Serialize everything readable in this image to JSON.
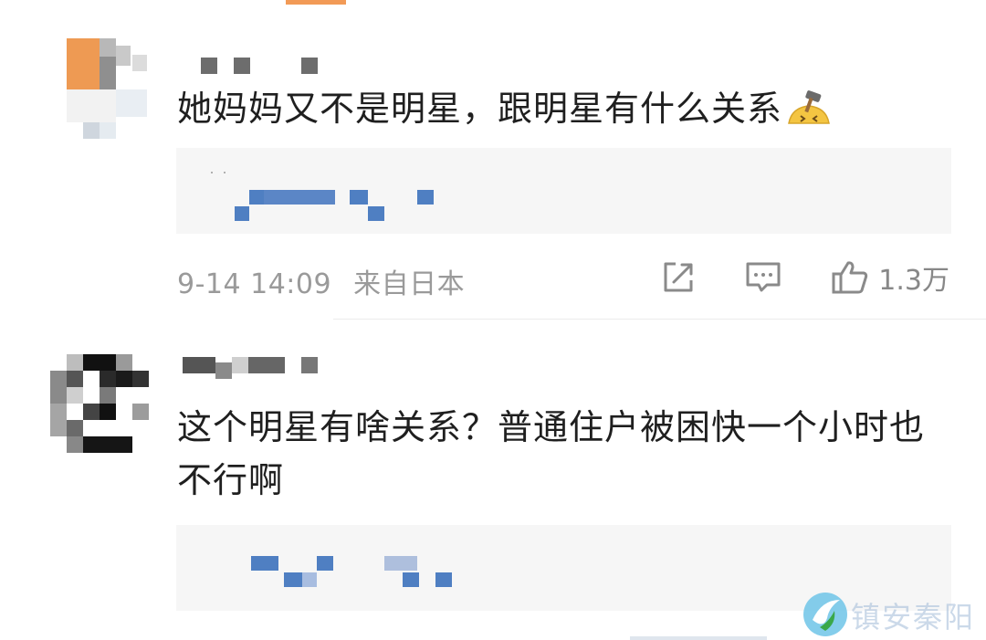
{
  "comments": [
    {
      "username": "",
      "text": "她妈妈又不是明星，跟明星有什么关系",
      "emoji": "hammer-emoji",
      "time": "9-14 14:09",
      "location": "来自日本",
      "like_count": "1.3万"
    },
    {
      "username": "",
      "text": "这个明星有啥关系？普通住户被困快一个小时也不行啊"
    }
  ],
  "watermark": {
    "text": "镇安秦阳"
  },
  "colors": {
    "meta_gray": "#9a9a9a",
    "link_blue": "#4f7fc2",
    "reply_bg": "#f6f6f6"
  }
}
